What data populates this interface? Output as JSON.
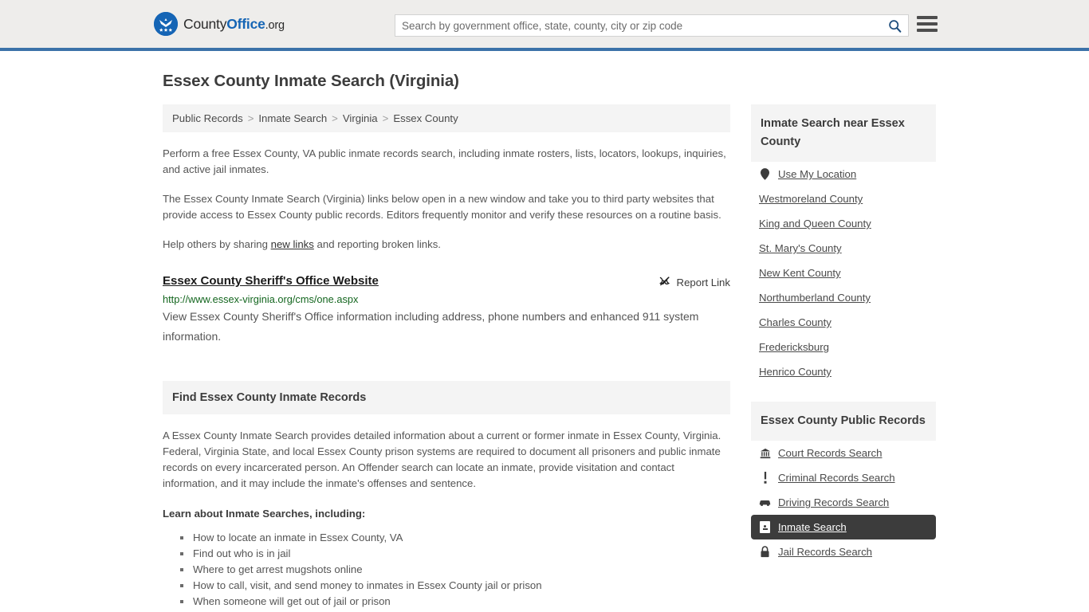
{
  "header": {
    "logo_county": "County",
    "logo_office": "Office",
    "logo_org": ".org",
    "search_placeholder": "Search by government office, state, county, city or zip code",
    "search_value": "",
    "search_icon": "search-icon",
    "menu_icon": "hamburger-menu-icon",
    "accent_color": "#3b72a8",
    "background_color": "#eeedeb"
  },
  "page": {
    "title": "Essex County Inmate Search (Virginia)"
  },
  "breadcrumb": {
    "separator": ">",
    "items": [
      {
        "label": "Public Records"
      },
      {
        "label": "Inmate Search"
      },
      {
        "label": "Virginia"
      },
      {
        "label": "Essex County"
      }
    ]
  },
  "intro": {
    "paragraph1": "Perform a free Essex County, VA public inmate records search, including inmate rosters, lists, locators, lookups, inquiries, and active jail inmates.",
    "paragraph2": "The Essex County Inmate Search (Virginia) links below open in a new window and take you to third party websites that provide access to Essex County public records. Editors frequently monitor and verify these resources on a routine basis.",
    "paragraph3_before": "Help others by sharing ",
    "paragraph3_link": "new links",
    "paragraph3_after": " and reporting broken links."
  },
  "result": {
    "title": "Essex County Sheriff's Office Website",
    "report_label": "Report Link",
    "report_icon": "broken-link-icon",
    "url": "http://www.essex-virginia.org/cms/one.aspx",
    "url_color": "#14661f",
    "description": "View Essex County Sheriff's Office information including address, phone numbers and enhanced 911 system information."
  },
  "section": {
    "heading": "Find Essex County Inmate Records",
    "body": "A Essex County Inmate Search provides detailed information about a current or former inmate in Essex County, Virginia. Federal, Virginia State, and local Essex County prison systems are required to document all prisoners and public inmate records on every incarcerated person. An Offender search can locate an inmate, provide visitation and contact information, and it may include the inmate's offenses and sentence.",
    "lead_in": "Learn about Inmate Searches, including:",
    "bullets": [
      "How to locate an inmate in Essex County, VA",
      "Find out who is in jail",
      "Where to get arrest mugshots online",
      "How to call, visit, and send money to inmates in Essex County jail or prison",
      "When someone will get out of jail or prison"
    ]
  },
  "sidebar": {
    "near_panel": {
      "heading": "Inmate Search near Essex County",
      "items": [
        {
          "label": "Use My Location",
          "icon": "map-pin-icon",
          "active": false
        },
        {
          "label": "Westmoreland County",
          "icon": "",
          "active": false
        },
        {
          "label": "King and Queen County",
          "icon": "",
          "active": false
        },
        {
          "label": "St. Mary's County",
          "icon": "",
          "active": false
        },
        {
          "label": "New Kent County",
          "icon": "",
          "active": false
        },
        {
          "label": "Northumberland County",
          "icon": "",
          "active": false
        },
        {
          "label": "Charles County",
          "icon": "",
          "active": false
        },
        {
          "label": "Fredericksburg",
          "icon": "",
          "active": false
        },
        {
          "label": "Henrico County",
          "icon": "",
          "active": false
        }
      ]
    },
    "records_panel": {
      "heading": "Essex County Public Records",
      "items": [
        {
          "label": "Court Records Search",
          "icon": "courthouse-icon",
          "active": false
        },
        {
          "label": "Criminal Records Search",
          "icon": "exclamation-icon",
          "active": false
        },
        {
          "label": "Driving Records Search",
          "icon": "car-icon",
          "active": false
        },
        {
          "label": "Inmate Search",
          "icon": "id-card-icon",
          "active": true
        },
        {
          "label": "Jail Records Search",
          "icon": "lock-icon",
          "active": false
        }
      ]
    }
  }
}
